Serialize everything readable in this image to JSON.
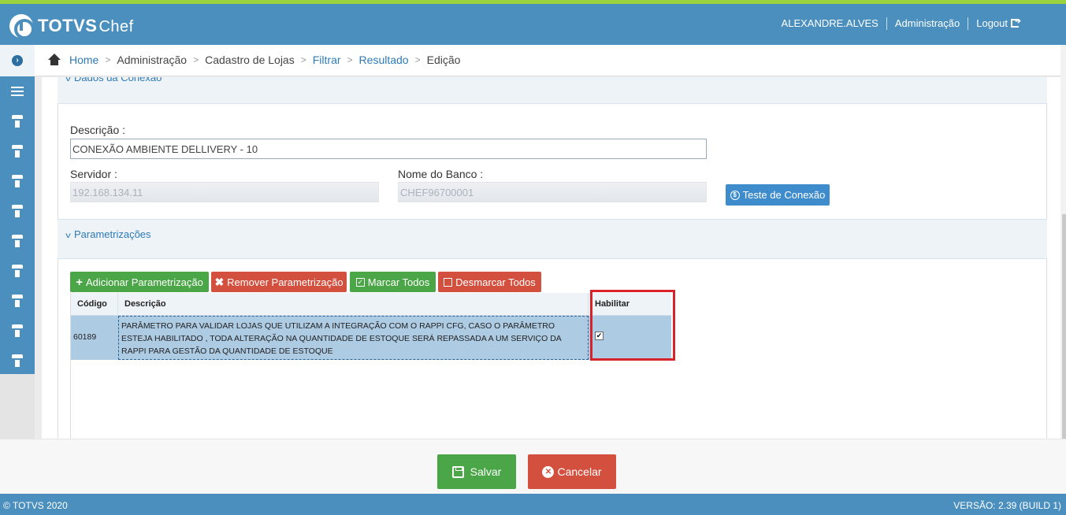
{
  "header": {
    "brand_bold": "TOTVS",
    "brand_light": "Chef",
    "user": "ALEXANDRE.ALVES",
    "admin": "Administração",
    "logout": "Logout"
  },
  "breadcrumb": {
    "items": [
      {
        "label": "Home",
        "link": true
      },
      {
        "label": "Administração",
        "link": false
      },
      {
        "label": "Cadastro de Lojas",
        "link": false
      },
      {
        "label": "Filtrar",
        "link": true
      },
      {
        "label": "Resultado",
        "link": true
      },
      {
        "label": "Edição",
        "link": false
      }
    ]
  },
  "connection": {
    "section_title": "Dados da Conexão",
    "descricao_label": "Descrição :",
    "descricao_value": "CONEXÃO AMBIENTE DELLIVERY - 10",
    "servidor_label": "Servidor :",
    "servidor_value": "192.168.134.11",
    "banco_label": "Nome do Banco :",
    "banco_value": "CHEF96700001",
    "test_button": "Teste de Conexão"
  },
  "parametrizacoes": {
    "section_title": "Parametrizações",
    "buttons": {
      "add": "Adicionar Parametrização",
      "remove": "Remover Parametrização",
      "mark_all": "Marcar Todos",
      "unmark_all": "Desmarcar Todos"
    },
    "columns": [
      "Código",
      "Descrição",
      "Habilitar"
    ],
    "rows": [
      {
        "codigo": "60189",
        "descricao": "PARÂMETRO PARA VALIDAR LOJAS QUE UTILIZAM A INTEGRAÇÃO COM O RAPPI CFG, CASO O PARÂMETRO ESTEJA HABILITADO , TODA ALTERAÇÃO NA QUANTIDADE DE ESTOQUE SERÁ REPASSADA A UM SERVIÇO DA RAPPI PARA GESTÃO DA QUANTIDADE DE ESTOQUE",
        "habilitar": true
      }
    ]
  },
  "actions": {
    "save": "Salvar",
    "cancel": "Cancelar"
  },
  "footer": {
    "copyright": "© TOTVS 2020",
    "version": "VERSÃO: 2.39 (BUILD 1)"
  },
  "colors": {
    "header": "#4a8fbd",
    "accent_green_line": "#9bd13c",
    "highlight_box": "#d8232a"
  }
}
